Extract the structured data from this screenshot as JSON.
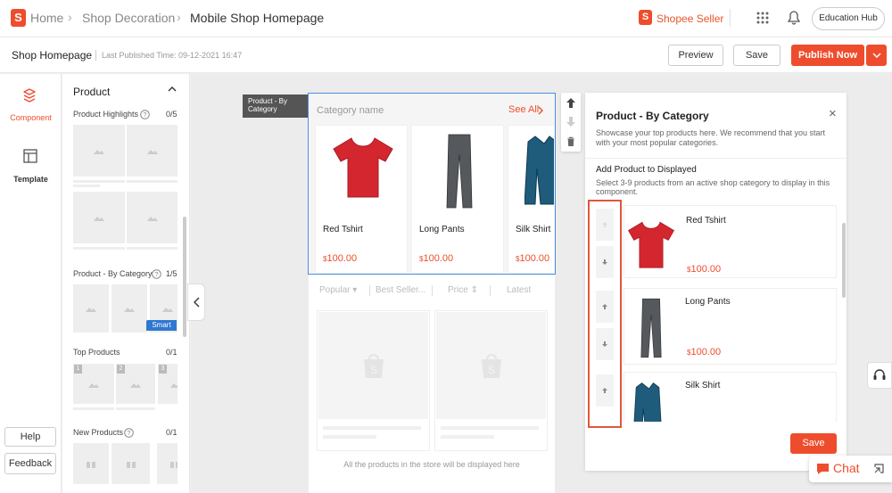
{
  "breadcrumb": {
    "home": "Home",
    "shop_decoration": "Shop Decoration",
    "current": "Mobile Shop Homepage"
  },
  "header": {
    "seller_name": "Shopee Seller",
    "education_hub": "Education Hub"
  },
  "subheader": {
    "page_name": "Shop Homepage",
    "last_published": "Last Published Time: 09-12-2021 16:47",
    "preview": "Preview",
    "save": "Save",
    "publish": "Publish Now"
  },
  "leftnav": {
    "component": "Component",
    "template": "Template",
    "help": "Help",
    "feedback": "Feedback"
  },
  "panel": {
    "title": "Product",
    "sections": [
      {
        "name": "Product Highlights",
        "count": "0/5"
      },
      {
        "name": "Product - By Category",
        "count": "1/5",
        "badge": "Smart"
      },
      {
        "name": "Top Products",
        "count": "0/1",
        "ranks": [
          "1",
          "2",
          "3"
        ]
      },
      {
        "name": "New Products",
        "count": "0/1"
      }
    ]
  },
  "canvas": {
    "component_tag": "Product - By Category",
    "category_name": "Category name",
    "see_all": "See All",
    "products": [
      {
        "name": "Red Tshirt",
        "currency": "$",
        "price": "100.00",
        "color": "#d3262f"
      },
      {
        "name": "Long Pants",
        "currency": "$",
        "price": "100.00",
        "color": "#55585c"
      },
      {
        "name": "Silk Shirt",
        "currency": "$",
        "price": "100.00",
        "color": "#1f5b7a"
      }
    ],
    "sort_tabs": [
      "Popular",
      "Best Seller...",
      "Price",
      "Latest"
    ],
    "footer_text": "All the products in the store will be displayed here"
  },
  "right_panel": {
    "title": "Product - By Category",
    "description": "Showcase your top products here. We recommend that you start with your most popular categories.",
    "subtitle": "Add Product to Displayed",
    "subdesc": "Select 3-9 products from an active shop category to display in this component.",
    "items": [
      {
        "name": "Red Tshirt",
        "currency": "$",
        "price": "100.00"
      },
      {
        "name": "Long Pants",
        "currency": "$",
        "price": "100.00"
      },
      {
        "name": "Silk Shirt"
      }
    ],
    "save": "Save"
  },
  "chat": {
    "label": "Chat"
  },
  "colors": {
    "brand": "#ee4d2d",
    "selected_border": "#4a90e2",
    "highlight_box": "#e0573b"
  }
}
